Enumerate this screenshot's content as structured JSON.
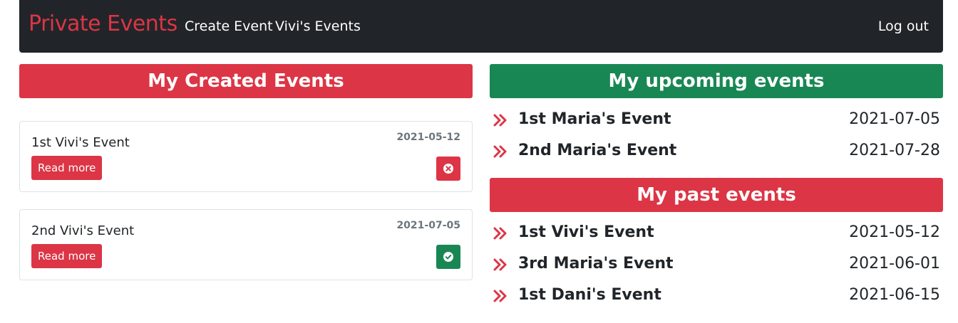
{
  "navbar": {
    "brand": "Private Events",
    "links": [
      "Create Event",
      "Vivi's Events"
    ],
    "logout": "Log out"
  },
  "created": {
    "heading": "My Created Events",
    "cards": [
      {
        "title": "1st Vivi's Event",
        "date": "2021-05-12",
        "button": "Read more",
        "status": "x-circle-icon"
      },
      {
        "title": "2nd Vivi's Event",
        "date": "2021-07-05",
        "button": "Read more",
        "status": "check-circle-icon"
      }
    ]
  },
  "upcoming": {
    "heading": "My upcoming events",
    "events": [
      {
        "name": "1st Maria's Event",
        "date": "2021-07-05"
      },
      {
        "name": "2nd Maria's Event",
        "date": "2021-07-28"
      }
    ]
  },
  "past": {
    "heading": "My past events",
    "events": [
      {
        "name": "1st Vivi's Event",
        "date": "2021-05-12"
      },
      {
        "name": "3rd Maria's Event",
        "date": "2021-06-01"
      },
      {
        "name": "1st Dani's Event",
        "date": "2021-06-15"
      }
    ]
  },
  "colors": {
    "navbar_bg": "#212529",
    "brand": "#dc3545",
    "danger": "#dc3545",
    "success": "#198754"
  }
}
